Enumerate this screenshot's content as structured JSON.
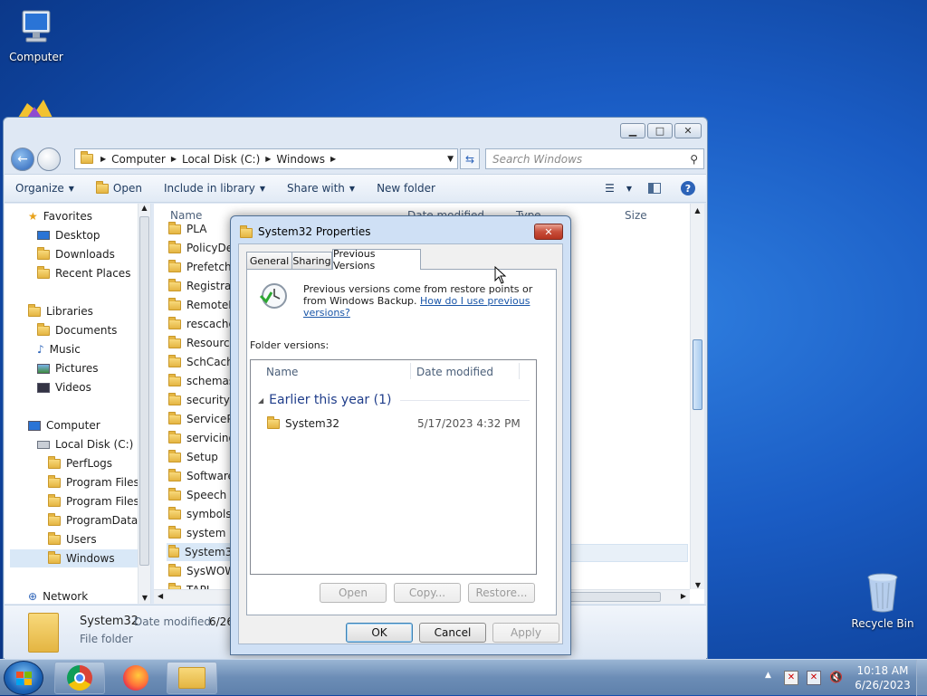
{
  "desktop": {
    "icons": [
      {
        "label": "Computer"
      },
      {
        "label": "Recycle Bin"
      }
    ]
  },
  "explorer": {
    "breadcrumb": [
      "Computer",
      "Local Disk (C:)",
      "Windows"
    ],
    "search_placeholder": "Search Windows",
    "toolbar": {
      "organize": "Organize",
      "open": "Open",
      "include": "Include in library",
      "share": "Share with",
      "new_folder": "New folder"
    },
    "nav": {
      "favorites": "Favorites",
      "desktop": "Desktop",
      "downloads": "Downloads",
      "recent": "Recent Places",
      "libraries": "Libraries",
      "documents": "Documents",
      "music": "Music",
      "pictures": "Pictures",
      "videos": "Videos",
      "computer": "Computer",
      "local_disk": "Local Disk (C:)",
      "perflogs": "PerfLogs",
      "program_files": "Program Files",
      "program_files_x86": "Program Files (",
      "programdata": "ProgramData",
      "users": "Users",
      "windows": "Windows",
      "network": "Network"
    },
    "columns": {
      "name": "Name",
      "date": "Date modified",
      "type": "Type",
      "size": "Size"
    },
    "files": [
      "PLA",
      "PolicyDe",
      "Prefetch",
      "Registrat",
      "RemoteP",
      "rescache",
      "Resource",
      "SchCach",
      "schemas",
      "security",
      "ServicePr",
      "servicing",
      "Setup",
      "Software",
      "Speech",
      "symbols",
      "system",
      "System32",
      "SysWOW",
      "TAPI"
    ],
    "details": {
      "name": "System32",
      "date_label": "Date modified:",
      "date_value": "6/26",
      "type": "File folder"
    }
  },
  "dialog": {
    "title": "System32 Properties",
    "tabs": [
      "General",
      "Sharing",
      "Previous Versions"
    ],
    "info_text": "Previous versions come from restore points or from Windows Backup.",
    "help_link": "How do I use previous versions?",
    "folder_versions_label": "Folder versions:",
    "list_columns": {
      "name": "Name",
      "date": "Date modified"
    },
    "group_label": "Earlier this year (1)",
    "versions": [
      {
        "name": "System32",
        "date": "5/17/2023 4:32 PM"
      }
    ],
    "action_buttons": {
      "open": "Open",
      "copy": "Copy...",
      "restore": "Restore..."
    },
    "buttons": {
      "ok": "OK",
      "cancel": "Cancel",
      "apply": "Apply"
    }
  },
  "taskbar": {
    "time": "10:18 AM",
    "date": "6/26/2023"
  },
  "colors": {
    "link": "#1a56a8",
    "group_header": "#1f3d8a",
    "selection": "#cce4f7"
  }
}
